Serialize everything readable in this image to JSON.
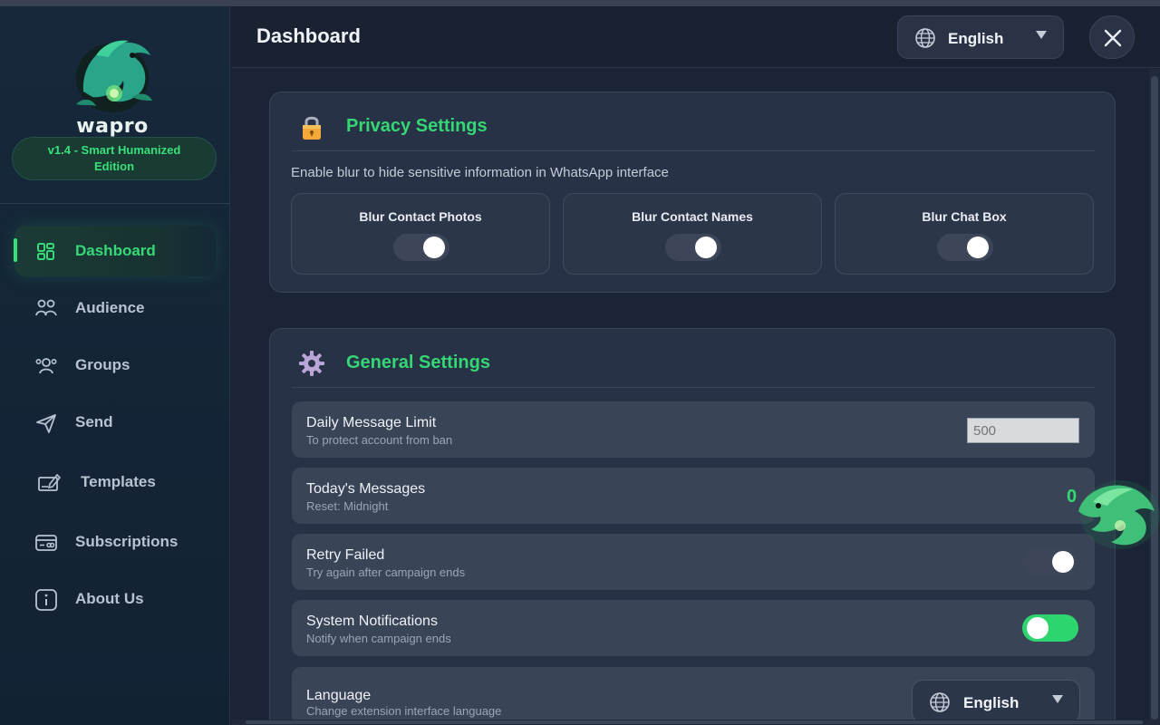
{
  "app": {
    "logo_text": "wapro",
    "version": "v1.4 - Smart Humanized Edition"
  },
  "sidebar": {
    "items": [
      {
        "label": "Dashboard",
        "icon": "dashboard-icon",
        "active": true
      },
      {
        "label": "Audience",
        "icon": "audience-icon",
        "active": false
      },
      {
        "label": "Groups",
        "icon": "groups-icon",
        "active": false
      },
      {
        "label": "Send",
        "icon": "send-icon",
        "active": false
      },
      {
        "label": "Templates",
        "icon": "templates-icon",
        "active": false
      },
      {
        "label": "Subscriptions",
        "icon": "subscriptions-icon",
        "active": false
      },
      {
        "label": "About Us",
        "icon": "info-icon",
        "active": false
      }
    ]
  },
  "header": {
    "title": "Dashboard",
    "language": "English"
  },
  "privacy": {
    "title": "Privacy Settings",
    "description": "Enable blur to hide sensitive information in WhatsApp interface",
    "options": [
      {
        "label": "Blur Contact Photos",
        "enabled": false
      },
      {
        "label": "Blur Contact Names",
        "enabled": false
      },
      {
        "label": "Blur Chat Box",
        "enabled": false
      }
    ]
  },
  "general": {
    "title": "General Settings",
    "daily_limit": {
      "title": "Daily Message Limit",
      "subtitle": "To protect account from ban",
      "placeholder": "500"
    },
    "todays_messages": {
      "title": "Today's Messages",
      "subtitle": "Reset: Midnight",
      "value": "0"
    },
    "retry_failed": {
      "title": "Retry Failed",
      "subtitle": "Try again after campaign ends",
      "enabled": false
    },
    "notifications": {
      "title": "System Notifications",
      "subtitle": "Notify when campaign ends",
      "enabled": true
    },
    "language": {
      "title": "Language",
      "subtitle": "Change extension interface language",
      "value": "English"
    }
  },
  "colors": {
    "accent_green": "#34d774",
    "background": "#1b2436",
    "card": "#283246"
  }
}
